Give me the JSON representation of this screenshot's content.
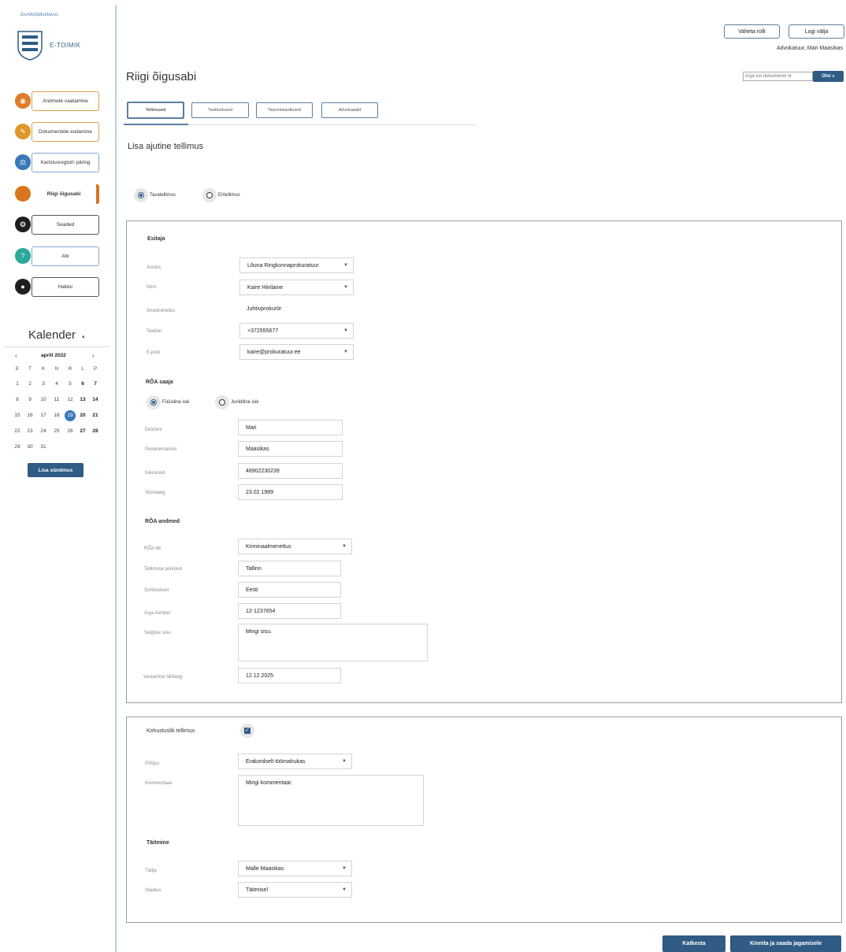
{
  "sidebar": {
    "top_link": "Juurdepääsetavus",
    "logo_text": "E-TOIMIK",
    "nav": [
      {
        "label": "Andmete vaatamine",
        "icon": "eye-icon",
        "color": "#e07b2a"
      },
      {
        "label": "Dokumentide esitamine",
        "icon": "pen-icon",
        "color": "#e0962a"
      },
      {
        "label": "Karistusregistri päring",
        "icon": "gavel-icon",
        "color": "#3b79b8"
      },
      {
        "label": "Riigi õigusabi",
        "icon": "circle-icon",
        "color": "#d9751e"
      },
      {
        "label": "Seaded",
        "icon": "gear-icon",
        "color": "#1e1e1e"
      },
      {
        "label": "Abi",
        "icon": "question-icon",
        "color": "#2aa89a"
      },
      {
        "label": "Haldur",
        "icon": "user-icon",
        "color": "#1e1e1e"
      }
    ],
    "calendar": {
      "title": "Kalender",
      "month": "aprill 2022",
      "weekdays": [
        "E",
        "T",
        "K",
        "N",
        "R",
        "L",
        "P"
      ],
      "weeks": [
        [
          "1",
          "2",
          "3",
          "4",
          "5",
          "6",
          "7"
        ],
        [
          "8",
          "9",
          "10",
          "11",
          "12",
          "13",
          "14"
        ],
        [
          "15",
          "16",
          "17",
          "18",
          "19",
          "20",
          "21"
        ],
        [
          "22",
          "23",
          "24",
          "25",
          "26",
          "27",
          "28"
        ],
        [
          "29",
          "30",
          "31",
          "",
          "",
          "",
          ""
        ]
      ],
      "today": "19",
      "add_event": "Lisa sündmus"
    }
  },
  "header": {
    "switch_role": "Vaheta rolli",
    "logout": "Logi välja",
    "user": "Advokatuur, Mari Maasikas",
    "search_placeholder": "Asja või dokumendi nr",
    "search_button": "Otsi"
  },
  "page_title": "Riigi õigusabi",
  "tabs": [
    "Tellimused",
    "Taotlustused",
    "Tasumistaotlused",
    "Advokaadid"
  ],
  "form_title": "Lisa ajutine tellimus",
  "order_type": {
    "options": [
      "Tavatellimus",
      "Eritellimus"
    ],
    "selected": 0
  },
  "requester": {
    "heading": "Esitaja",
    "fields": [
      {
        "label": "Asutus",
        "value": "Lõuna Ringkonnaprokuratuur",
        "dropdown": true
      },
      {
        "label": "Nimi",
        "value": "Kaire Hiirilaine",
        "dropdown": true
      },
      {
        "label": "Ametinimetus",
        "value": "Juhtivprokurör",
        "dropdown": false
      },
      {
        "label": "Telefon",
        "value": "+372555677",
        "dropdown": true
      },
      {
        "label": "E-post",
        "value": "kaire@prokuratuur.ee",
        "dropdown": true
      }
    ]
  },
  "recipient": {
    "heading": "RÕA saaja",
    "person_type": {
      "options": [
        "Füüsiline isik",
        "Juriidiline isik"
      ],
      "selected": 0
    },
    "fields": [
      {
        "label": "Eesnimi",
        "value": "Mari"
      },
      {
        "label": "Perekonnanimi",
        "value": "Maasikas"
      },
      {
        "label": "Isikukood",
        "value": "48902230239"
      },
      {
        "label": "Sünniaeg",
        "value": "23.02.1989"
      }
    ]
  },
  "roa": {
    "heading": "RÕA andmed",
    "type_label": "RÕA liik",
    "type_value": "Kriminaalmenetlus",
    "fields": [
      {
        "label": "Tellimuse piirkond",
        "value": "Tallinn"
      },
      {
        "label": "Suhtluskeel",
        "value": "Eesti"
      },
      {
        "label": "Asja number",
        "value": "12-1237654"
      }
    ],
    "desc_label": "Selgitav sisu",
    "desc_value": "Mingi sisu.",
    "deadline_label": "Vastamise tähtaeg",
    "deadline_value": "12.12.2025"
  },
  "mandatory": {
    "label": "Kohustuslik tellimus",
    "checked": true,
    "reason_label": "Põhjus",
    "reason_value": "Erakordselt töömahukas",
    "comment_label": "Kommentaar",
    "comment_value": "Mingi kommentaar."
  },
  "fulfilment": {
    "heading": "Täitmine",
    "fields": [
      {
        "label": "Täitja",
        "value": "Malle Maasikas"
      },
      {
        "label": "Staatus",
        "value": "Täitmisel"
      }
    ]
  },
  "footer": {
    "cancel": "Katkesta",
    "confirm": "Kinnita ja saada jagamisele"
  },
  "colors": {
    "brand": "#2f5b85",
    "accent": "#d9751e",
    "border": "#9c9c9c"
  }
}
